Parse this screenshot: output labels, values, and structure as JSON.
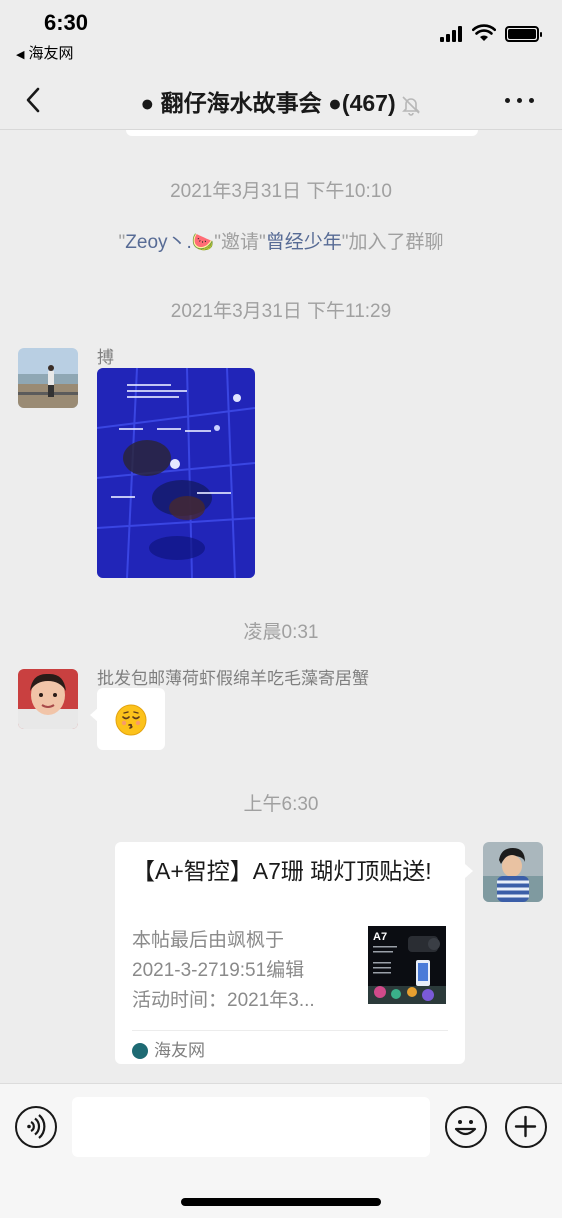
{
  "status_bar": {
    "time": "6:30",
    "back_app": "海友网"
  },
  "nav": {
    "title": "● 翻仔海水故事会 ●(467)",
    "icons": [
      "back-chevron-icon",
      "mute-bell-icon",
      "more-dots-icon"
    ]
  },
  "messages": {
    "ts1": "2021年3月31日 下午10:10",
    "system": {
      "q1": "\"",
      "inviter": "Zeoy丶.",
      "q2": "\"邀请\"",
      "invitee": "曾经少年",
      "q3": "\"加入了群聊"
    },
    "ts2": "2021年3月31日 下午11:29",
    "msg1_sender": "搏",
    "ts3": "凌晨0:31",
    "msg2_sender": "批发包邮薄荷虾假绵羊吃毛藻寄居蟹",
    "ts4": "上午6:30",
    "card": {
      "title": "【A+智控】A7珊 瑚灯顶贴送!",
      "desc_lines": [
        "本帖最后由飒枫于",
        "2021-3-2719:51编辑",
        "活动时间：2021年3..."
      ],
      "thumb_label": "A7",
      "source": "海友网"
    }
  },
  "input_bar": {
    "placeholder": "",
    "icons": [
      "voice-icon",
      "emoji-icon",
      "plus-icon"
    ]
  },
  "colors": {
    "background": "#ededed",
    "link_name": "#576b95",
    "timestamp": "#a0a0a0"
  }
}
